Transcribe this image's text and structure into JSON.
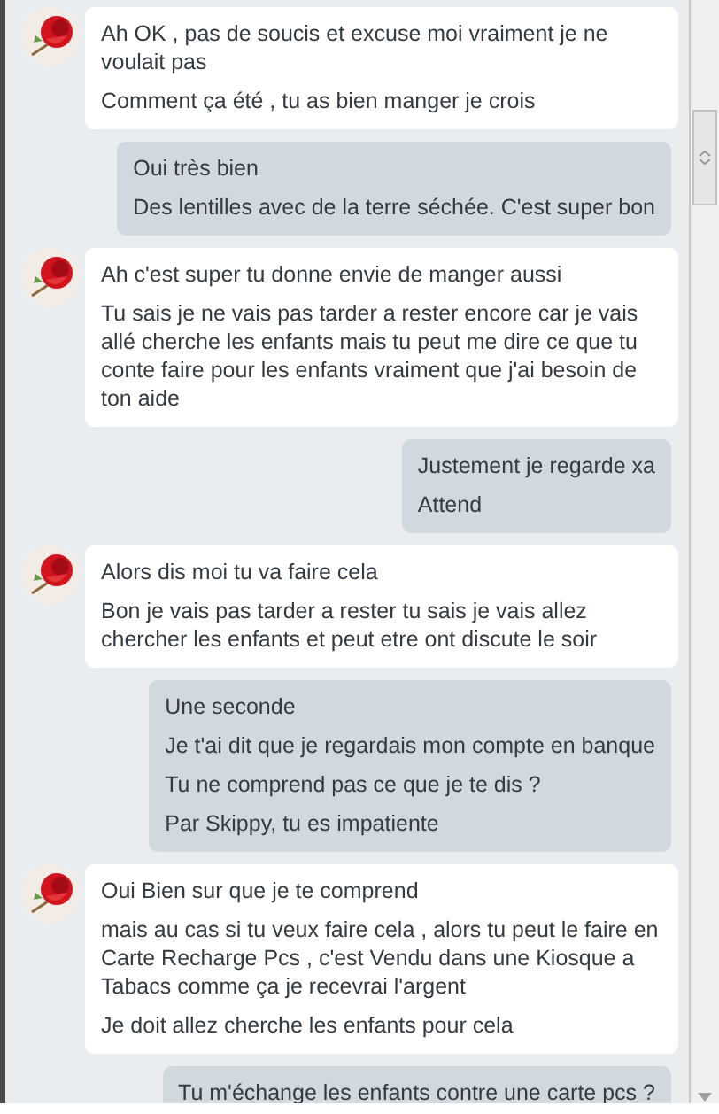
{
  "messages": [
    {
      "kind": "received",
      "lines": [
        "Ah OK , pas de soucis et excuse moi vraiment je ne voulait pas",
        "Comment ça été , tu as bien manger je crois"
      ]
    },
    {
      "kind": "sent",
      "lines": [
        "Oui très bien",
        "Des lentilles avec de la terre séchée. C'est super bon"
      ]
    },
    {
      "kind": "received",
      "lines": [
        "Ah c'est super tu donne envie de manger aussi",
        "Tu sais je ne vais pas tarder a rester encore car je vais allé cherche les enfants mais tu peut me dire ce que tu conte faire pour les enfants vraiment que j'ai besoin de ton aide"
      ]
    },
    {
      "kind": "sent",
      "lines": [
        "Justement je regarde xa",
        "Attend"
      ]
    },
    {
      "kind": "received",
      "lines": [
        "Alors dis moi tu va faire cela",
        "Bon je vais pas tarder a rester tu sais je vais allez chercher les enfants et peut etre ont discute le soir"
      ]
    },
    {
      "kind": "sent",
      "lines": [
        "Une seconde",
        "Je t'ai dit que je regardais mon compte en banque",
        "Tu ne comprend pas ce que je te dis ?",
        "Par Skippy, tu es impatiente"
      ]
    },
    {
      "kind": "received",
      "lines": [
        "Oui Bien sur que je te comprend",
        "mais au cas si tu veux faire cela , alors tu peut le faire en Carte Recharge Pcs , c'est Vendu dans une Kiosque a Tabacs comme ça je recevrai l'argent",
        "Je doit allez cherche les enfants pour cela"
      ]
    },
    {
      "kind": "sent",
      "lines": [
        "Tu m'échange les enfants contre une carte pcs ?"
      ]
    }
  ]
}
